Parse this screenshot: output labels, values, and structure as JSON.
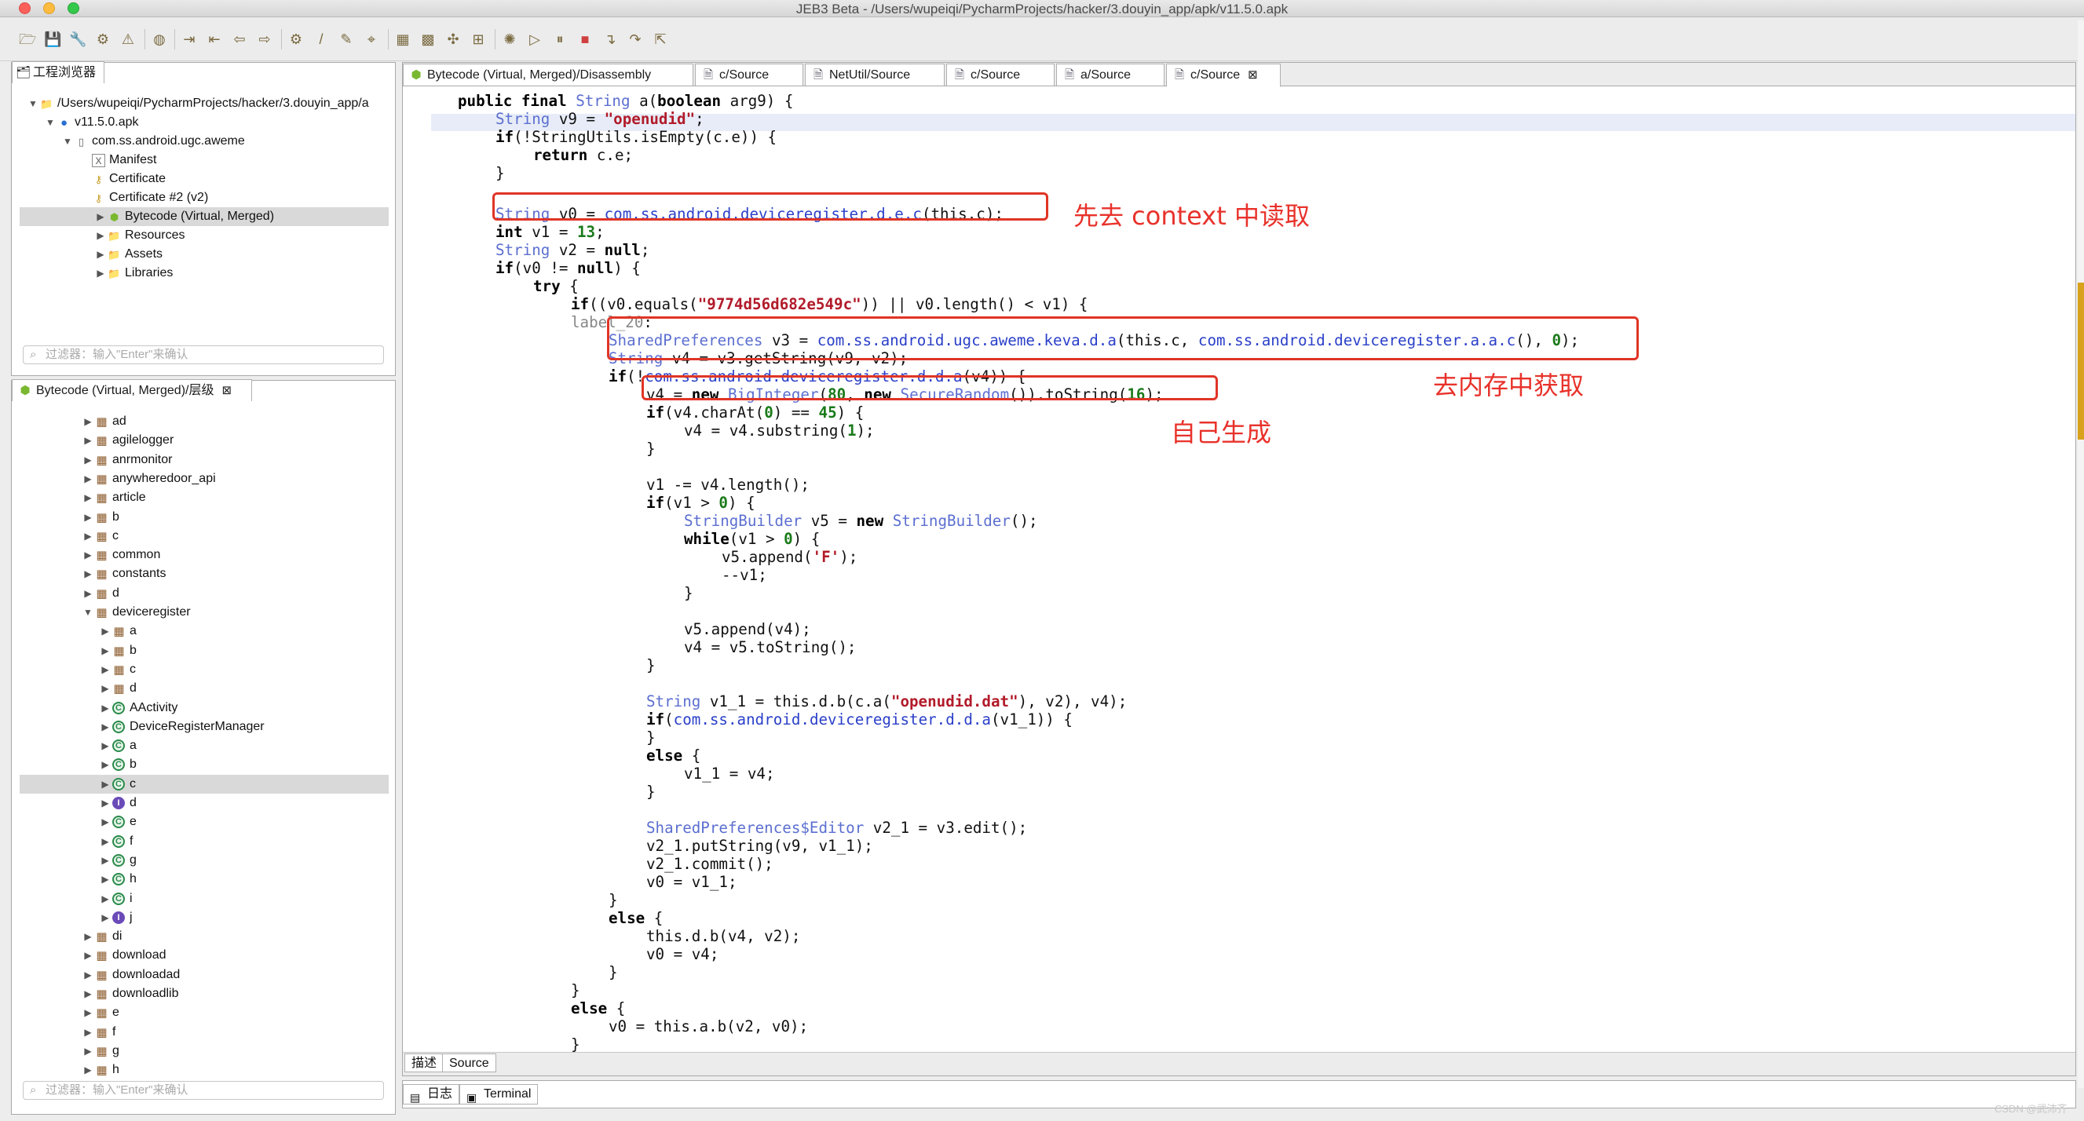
{
  "window": {
    "title": "JEB3 Beta - /Users/wupeiqi/PycharmProjects/hacker/3.douyin_app/apk/v11.5.0.apk"
  },
  "project_panel": {
    "tab_label": "工程浏览器",
    "items": [
      {
        "label": "/Users/wupeiqi/PycharmProjects/hacker/3.douyin_app/a"
      },
      {
        "label": "v11.5.0.apk"
      },
      {
        "label": "com.ss.android.ugc.aweme"
      },
      {
        "label": "Manifest"
      },
      {
        "label": "Certificate"
      },
      {
        "label": "Certificate #2 (v2)"
      },
      {
        "label": "Bytecode (Virtual, Merged)"
      },
      {
        "label": "Resources"
      },
      {
        "label": "Assets"
      },
      {
        "label": "Libraries"
      }
    ],
    "filter_placeholder": "过滤器：输入\"Enter\"来确认"
  },
  "hierarchy_panel": {
    "tab_label": "Bytecode (Virtual, Merged)/层级",
    "items": [
      {
        "label": "ad"
      },
      {
        "label": "agilelogger"
      },
      {
        "label": "anrmonitor"
      },
      {
        "label": "anywheredoor_api"
      },
      {
        "label": "article"
      },
      {
        "label": "b"
      },
      {
        "label": "c"
      },
      {
        "label": "common"
      },
      {
        "label": "constants"
      },
      {
        "label": "d"
      },
      {
        "label": "deviceregister"
      },
      {
        "label": "a"
      },
      {
        "label": "b"
      },
      {
        "label": "c"
      },
      {
        "label": "d"
      },
      {
        "label": "AActivity"
      },
      {
        "label": "DeviceRegisterManager"
      },
      {
        "label": "a"
      },
      {
        "label": "b"
      },
      {
        "label": "c"
      },
      {
        "label": "d"
      },
      {
        "label": "e"
      },
      {
        "label": "f"
      },
      {
        "label": "g"
      },
      {
        "label": "h"
      },
      {
        "label": "i"
      },
      {
        "label": "j"
      },
      {
        "label": "di"
      },
      {
        "label": "download"
      },
      {
        "label": "downloadad"
      },
      {
        "label": "downloadlib"
      },
      {
        "label": "e"
      },
      {
        "label": "f"
      },
      {
        "label": "g"
      },
      {
        "label": "h"
      }
    ],
    "filter_placeholder": "过滤器：输入\"Enter\"来确认"
  },
  "editor_tabs": [
    {
      "label": "Bytecode (Virtual, Merged)/Disassembly"
    },
    {
      "label": "c/Source"
    },
    {
      "label": "NetUtil/Source"
    },
    {
      "label": "c/Source"
    },
    {
      "label": "a/Source"
    },
    {
      "label": "c/Source"
    }
  ],
  "annotations": {
    "a1": "先去 context 中读取",
    "a2": "去内存中获取",
    "a3": "自己生成"
  },
  "bottom_tabs": {
    "describe": "描述",
    "source": "Source"
  },
  "console_tabs": {
    "log": "日志",
    "terminal": "Terminal"
  },
  "watermark": "CSDN @武沛齐",
  "code_lines": [
    "public final String a(boolean arg9) {",
    "String v9 = \"openudid\";",
    "if(!StringUtils.isEmpty(c.e)) {",
    "return c.e;",
    "}",
    "String v0 = com.ss.android.deviceregister.d.e.c(this.c);",
    "int v1 = 13;",
    "String v2 = null;",
    "if(v0 != null) {",
    "try {",
    "if((v0.equals(\"9774d56d682e549c\")) || v0.length() < v1) {",
    "label_20:",
    "SharedPreferences v3 = com.ss.android.ugc.aweme.keva.d.a(this.c, com.ss.android.deviceregister.a.a.c(), 0);",
    "String v4 = v3.getString(v9, v2);",
    "if(!com.ss.android.deviceregister.d.d.a(v4)) {",
    "v4 = new BigInteger(80, new SecureRandom()).toString(16);",
    "if(v4.charAt(0) == 45) {",
    "v4 = v4.substring(1);",
    "}",
    "v1 -= v4.length();",
    "if(v1 > 0) {",
    "StringBuilder v5 = new StringBuilder();",
    "while(v1 > 0) {",
    "v5.append('F');",
    "--v1;",
    "}",
    "v5.append(v4);",
    "v4 = v5.toString();",
    "}",
    "String v1_1 = this.d.b(c.a(\"openudid.dat\"), v2), v4);",
    "if(com.ss.android.deviceregister.d.d.a(v1_1)) {",
    "}",
    "else {",
    "v1_1 = v4;",
    "}",
    "SharedPreferences$Editor v2_1 = v3.edit();",
    "v2_1.putString(v9, v1_1);",
    "v2_1.commit();",
    "v0 = v1_1;",
    "}",
    "else {",
    "this.d.b(v4, v2);",
    "v0 = v4;",
    "}",
    "}",
    "else {",
    "v0 = this.a.b(v2, v0);",
    "}"
  ]
}
